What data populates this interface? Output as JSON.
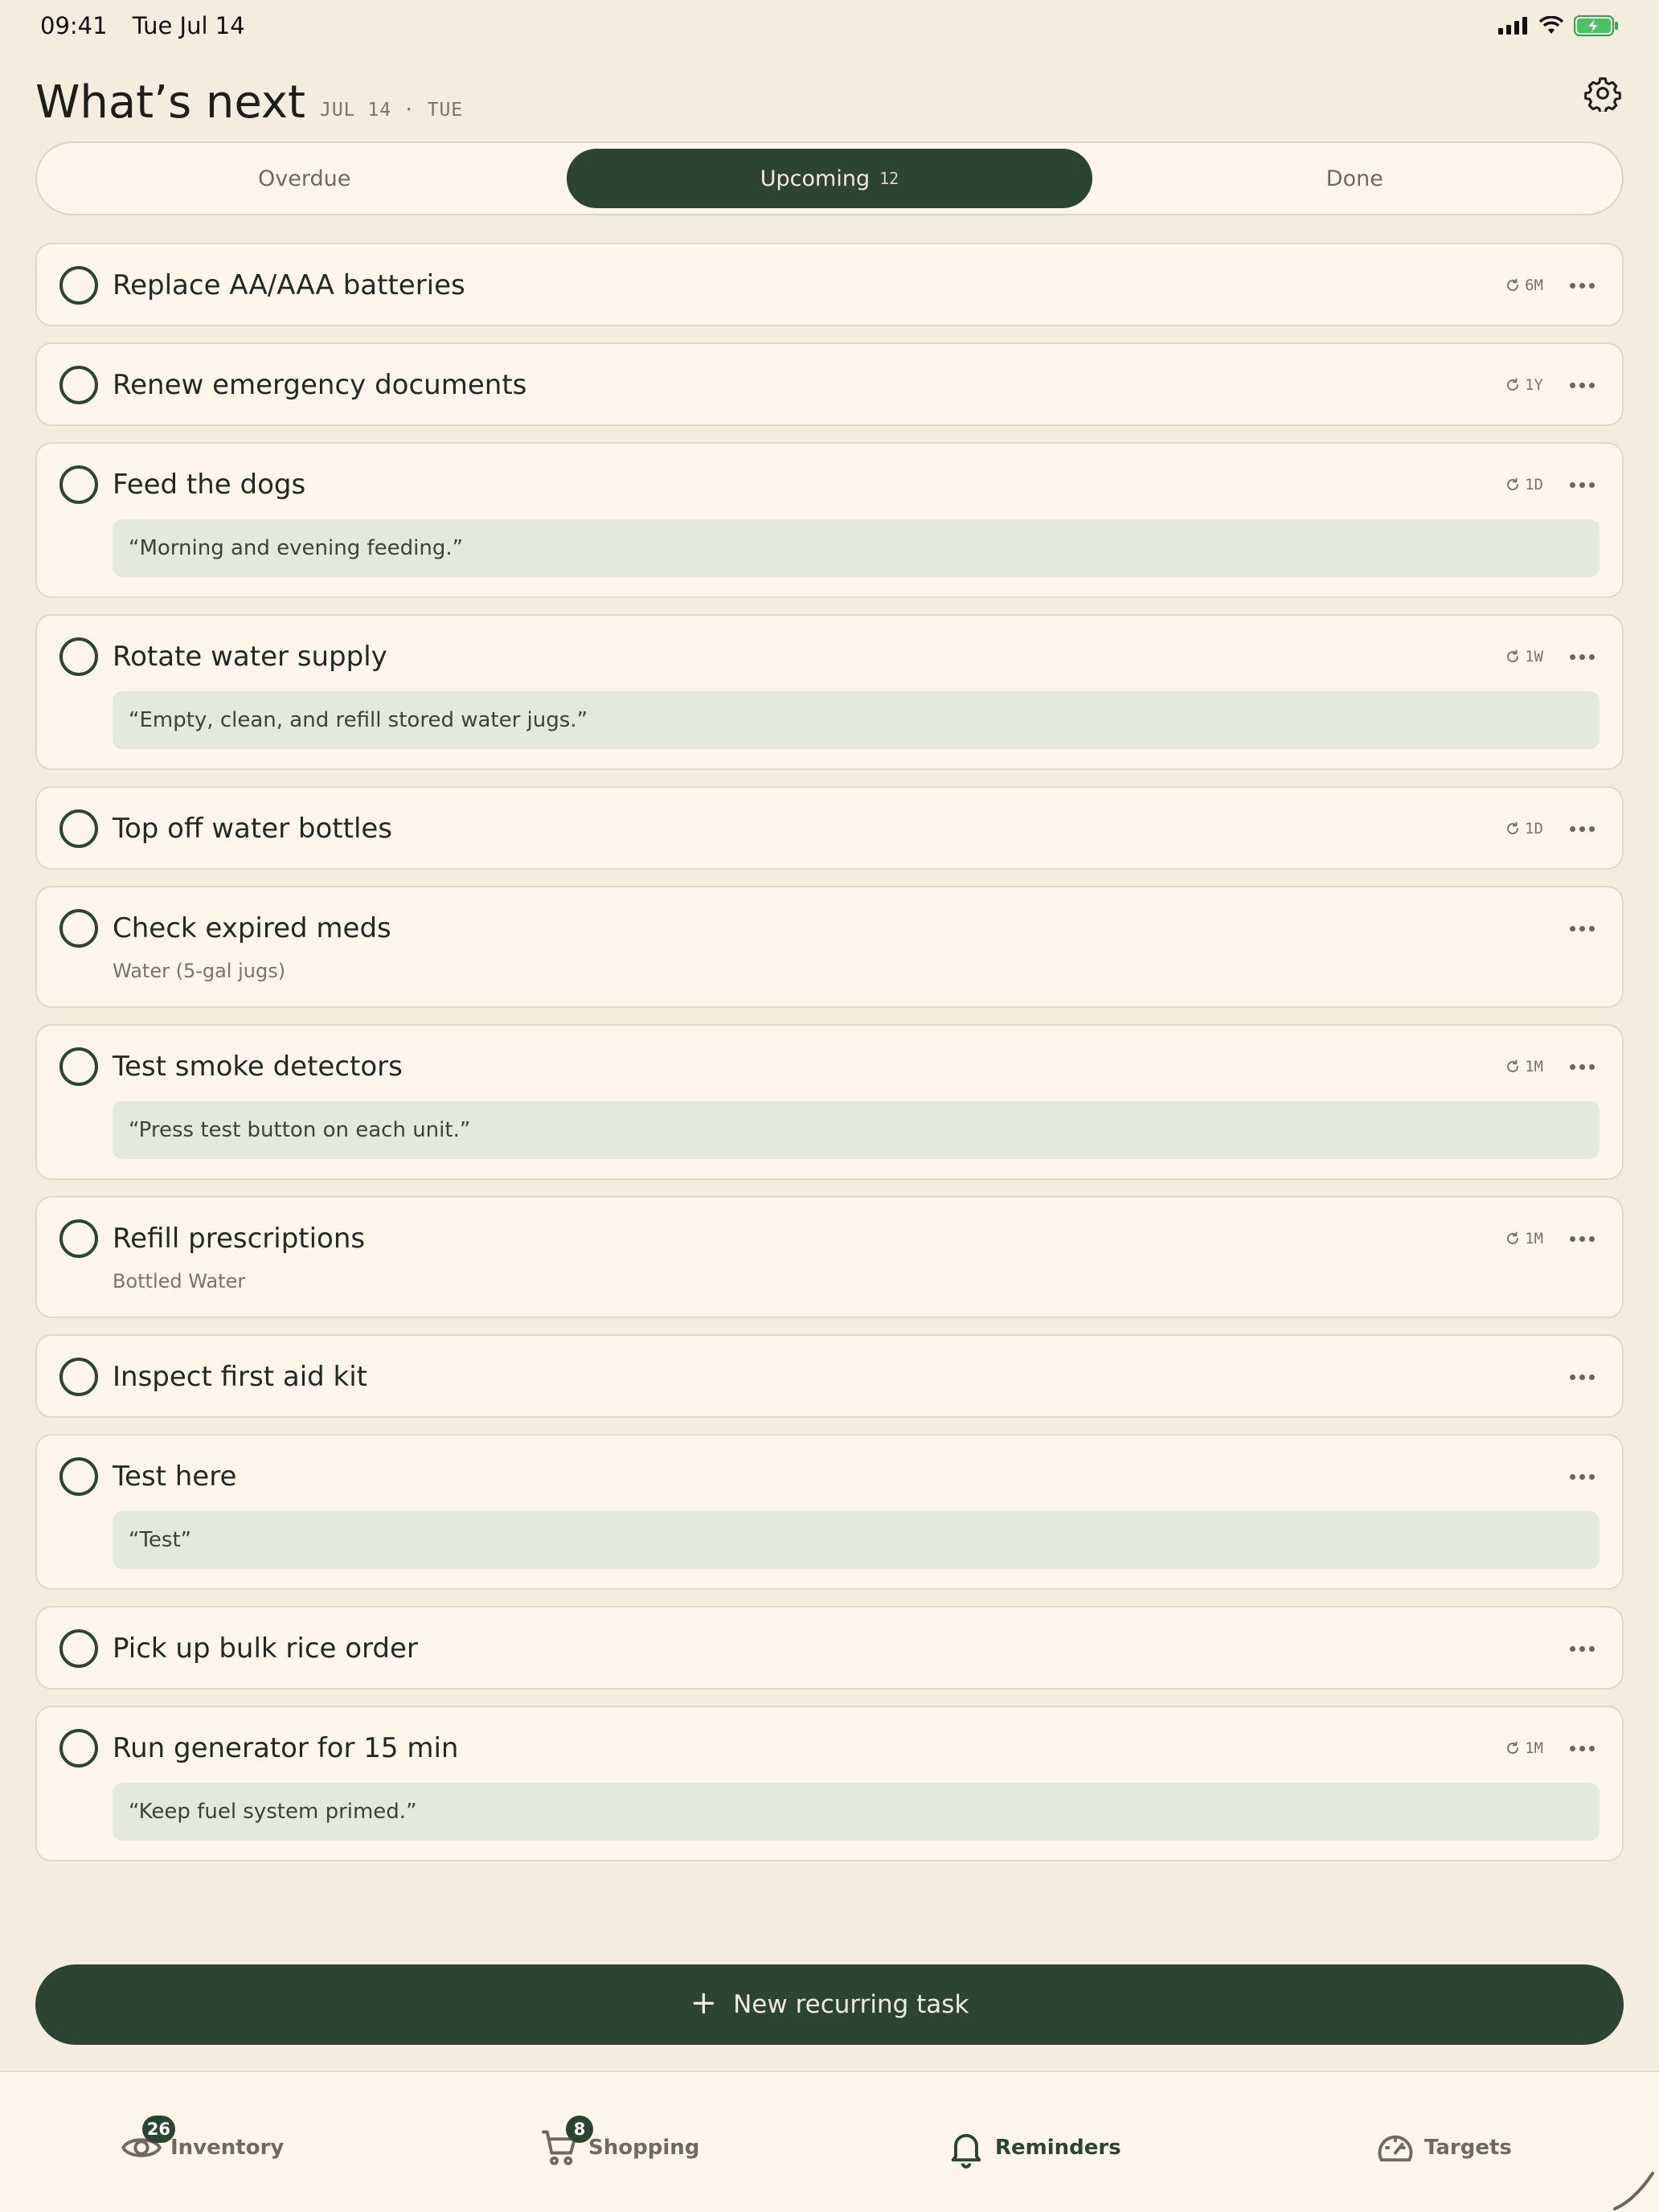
{
  "status_bar": {
    "time": "09:41",
    "date": "Tue Jul 14"
  },
  "header": {
    "title": "What’s next",
    "date": "JUL 14 · TUE"
  },
  "tabs": [
    {
      "label": "Overdue",
      "count": ""
    },
    {
      "label": "Upcoming",
      "count": "12"
    },
    {
      "label": "Done",
      "count": ""
    }
  ],
  "active_tab": "Upcoming",
  "tasks": [
    {
      "title": "Replace AA/AAA batteries",
      "recur": "6M"
    },
    {
      "title": "Renew emergency documents",
      "recur": "1Y"
    },
    {
      "title": "Feed the dogs",
      "recur": "1D",
      "note": "“Morning and evening feeding.”"
    },
    {
      "title": "Rotate water supply",
      "recur": "1W",
      "note": "“Empty, clean, and refill stored water jugs.”"
    },
    {
      "title": "Top off water bottles",
      "recur": "1D"
    },
    {
      "title": "Check expired meds",
      "sub": "Water (5-gal jugs)"
    },
    {
      "title": "Test smoke detectors",
      "recur": "1M",
      "note": "“Press test button on each unit.”"
    },
    {
      "title": "Refill prescriptions",
      "recur": "1M",
      "sub": "Bottled Water"
    },
    {
      "title": "Inspect first aid kit"
    },
    {
      "title": "Test here",
      "note": "“Test”"
    },
    {
      "title": "Pick up bulk rice order"
    },
    {
      "title": "Run generator for 15 min",
      "recur": "1M",
      "note": "“Keep fuel system primed.”"
    }
  ],
  "new_button": {
    "label": "New recurring task",
    "icon": "plus-icon"
  },
  "tabbar": {
    "items": [
      {
        "label": "Inventory",
        "icon": "eye-icon",
        "badge": "26"
      },
      {
        "label": "Shopping",
        "icon": "cart-icon",
        "badge": "8"
      },
      {
        "label": "Reminders",
        "icon": "bell-icon",
        "badge": ""
      },
      {
        "label": "Targets",
        "icon": "gauge-icon",
        "badge": ""
      }
    ],
    "active": "Reminders"
  },
  "colors": {
    "background": "#f3eddd",
    "card": "#fcf6ea",
    "accent": "#2c4530",
    "note_bg": "#e3ead9"
  }
}
